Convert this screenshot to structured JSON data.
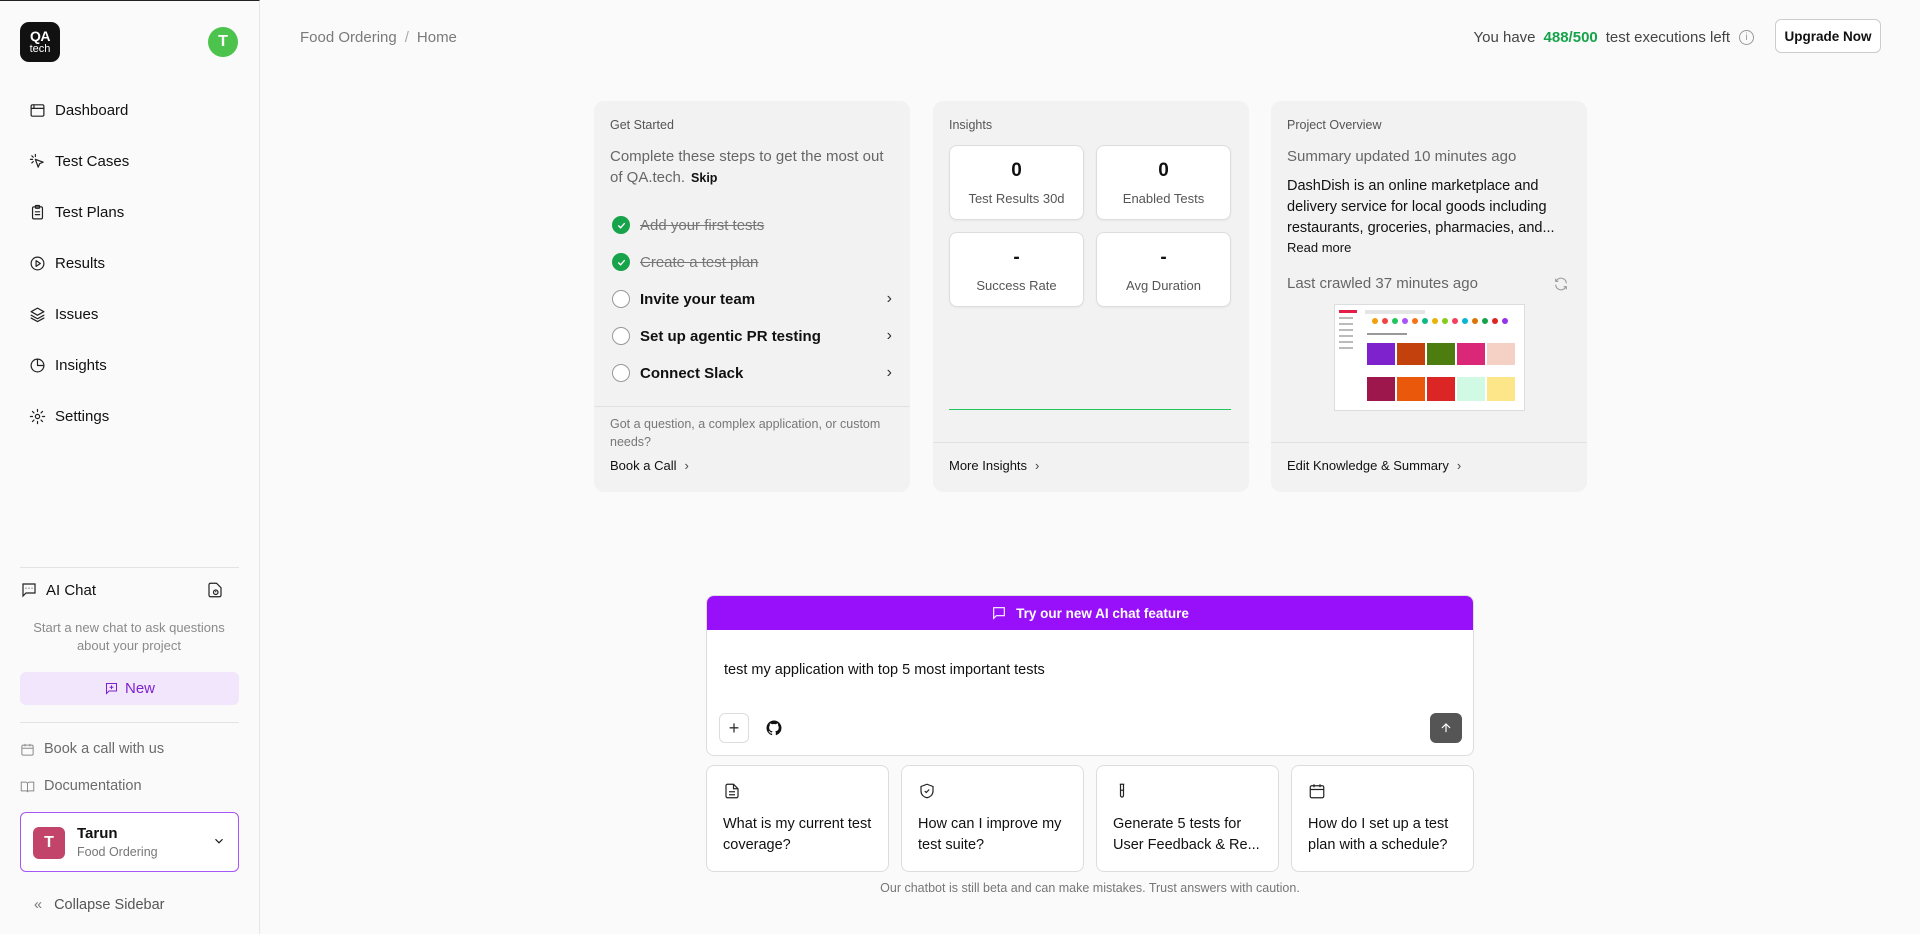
{
  "sidebar": {
    "logo_line1": "QA",
    "logo_line2": "tech",
    "avatar_initial": "T",
    "nav": [
      {
        "label": "Dashboard"
      },
      {
        "label": "Test Cases"
      },
      {
        "label": "Test Plans"
      },
      {
        "label": "Results"
      },
      {
        "label": "Issues"
      },
      {
        "label": "Insights"
      },
      {
        "label": "Settings"
      }
    ],
    "ai_chat_title": "AI Chat",
    "ai_chat_desc": "Start a new chat to ask questions about your project",
    "new_label": "New",
    "book_call": "Book a call with us",
    "documentation": "Documentation",
    "user": {
      "initial": "T",
      "name": "Tarun",
      "project": "Food Ordering"
    },
    "collapse": "Collapse Sidebar"
  },
  "header": {
    "breadcrumb": [
      "Food Ordering",
      "Home"
    ],
    "quota_prefix": "You have",
    "quota_value": "488/500",
    "quota_suffix": "test executions left",
    "upgrade": "Upgrade Now"
  },
  "get_started": {
    "title": "Get Started",
    "desc": "Complete these steps to get the most out of QA.tech.",
    "skip": "Skip",
    "steps": [
      {
        "label": "Add your first tests",
        "done": true
      },
      {
        "label": "Create a test plan",
        "done": true
      },
      {
        "label": "Invite your team",
        "done": false
      },
      {
        "label": "Set up agentic PR testing",
        "done": false
      },
      {
        "label": "Connect Slack",
        "done": false
      }
    ],
    "question": "Got a question, a complex application, or custom needs?",
    "book_call": "Book a Call"
  },
  "insights": {
    "title": "Insights",
    "stats": [
      {
        "value": "0",
        "label": "Test Results 30d"
      },
      {
        "value": "0",
        "label": "Enabled Tests"
      },
      {
        "value": "-",
        "label": "Success Rate"
      },
      {
        "value": "-",
        "label": "Avg Duration"
      }
    ],
    "more": "More Insights"
  },
  "project_overview": {
    "title": "Project Overview",
    "summary_updated": "Summary updated 10 minutes ago",
    "desc": "DashDish is an online marketplace and delivery service for local goods including restaurants, groceries, pharmacies, and...",
    "read_more": "Read more",
    "last_crawled": "Last crawled 37 minutes ago",
    "edit": "Edit Knowledge & Summary"
  },
  "chat": {
    "banner": "Try our new AI chat feature",
    "input_value": "test my application with top 5 most important tests",
    "suggestions": [
      {
        "icon": "document-icon",
        "text": "What is my current test coverage?"
      },
      {
        "icon": "shield-icon",
        "text": "How can I improve my test suite?"
      },
      {
        "icon": "test-tube-icon",
        "text": "Generate 5 tests for User Feedback & Re..."
      },
      {
        "icon": "calendar-icon",
        "text": "How do I set up a test plan with a schedule?"
      }
    ],
    "disclaimer": "Our chatbot is still beta and can make mistakes. Trust answers with caution."
  },
  "colors": {
    "accent": "#9810fa",
    "success": "#16a34a",
    "avatar_green": "#4cc34c",
    "user_avatar": "#c2446a"
  }
}
